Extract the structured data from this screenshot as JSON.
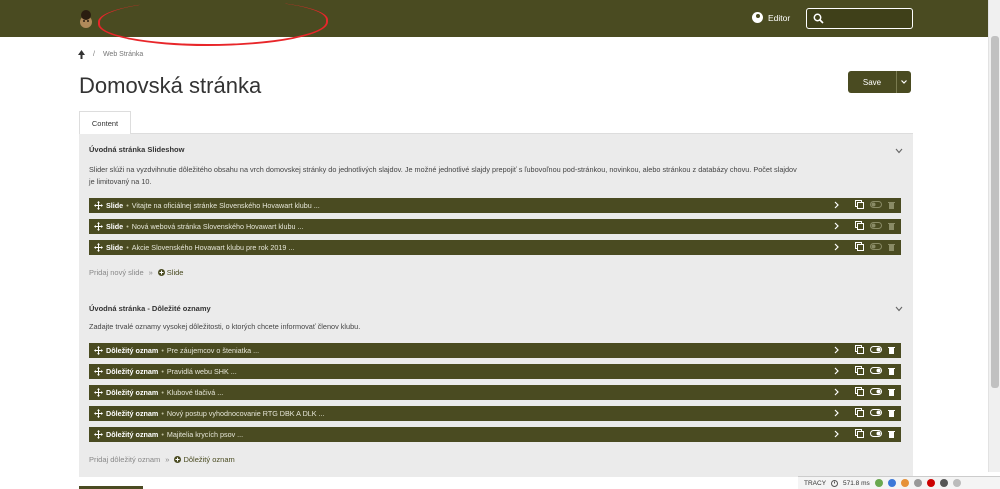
{
  "header": {
    "user_label": "Editor",
    "search_placeholder": ""
  },
  "breadcrumb": {
    "separator": "/",
    "current": "Web Stránka"
  },
  "page": {
    "title": "Domovská stránka",
    "save_label": "Save",
    "tab_label": "Content"
  },
  "sections": [
    {
      "title": "Úvodná stránka Slideshow",
      "description_line1": "Slider slúži na vyzdvihnutie dôležitého obsahu na vrch domovskej stránky do jednotlivých slajdov. Je možné jednotlivé slajdy prepojiť s ľubovoľnou pod-stránkou, novinkou, alebo stránkou z databázy chovu. Počet slajdov",
      "description_line2": "je limitovaný na 10.",
      "items": [
        {
          "type": "Slide",
          "text": "Vitajte na oficiálnej stránke Slovenského Hovawart klubu ..."
        },
        {
          "type": "Slide",
          "text": "Nová webová stránka Slovenského Hovawart klubu ..."
        },
        {
          "type": "Slide",
          "text": "Akcie Slovenského Hovawart klubu pre rok 2019 ..."
        }
      ],
      "add_prompt": "Pridaj nový slide",
      "add_separator": "»",
      "add_button": "Slide"
    },
    {
      "title": "Úvodná stránka - Dôležité oznamy",
      "description_line1": "Zadajte trvalé oznamy vysokej dôležitosti, o ktorých chcete informovať členov klubu.",
      "items": [
        {
          "type": "Dôležitý oznam",
          "text": "Pre záujemcov o šteniatka ..."
        },
        {
          "type": "Dôležitý oznam",
          "text": "Pravidlá webu SHK ..."
        },
        {
          "type": "Dôležitý oznam",
          "text": "Klubové tlačivá ..."
        },
        {
          "type": "Dôležitý oznam",
          "text": "Nový postup vyhodnocovanie RTG DBK A DLK ..."
        },
        {
          "type": "Dôležitý oznam",
          "text": "Majitelia krycích psov ..."
        }
      ],
      "add_prompt": "Pridaj dôležitý oznam",
      "add_separator": "»",
      "add_button": "Dôležitý oznam"
    }
  ],
  "item_separator": "•",
  "tracy": {
    "label": "TRACY",
    "time": "571.8 ms"
  },
  "colors": {
    "brand": "#4a4b21",
    "panel": "#ebebeb",
    "annotation": "#e8262a"
  }
}
